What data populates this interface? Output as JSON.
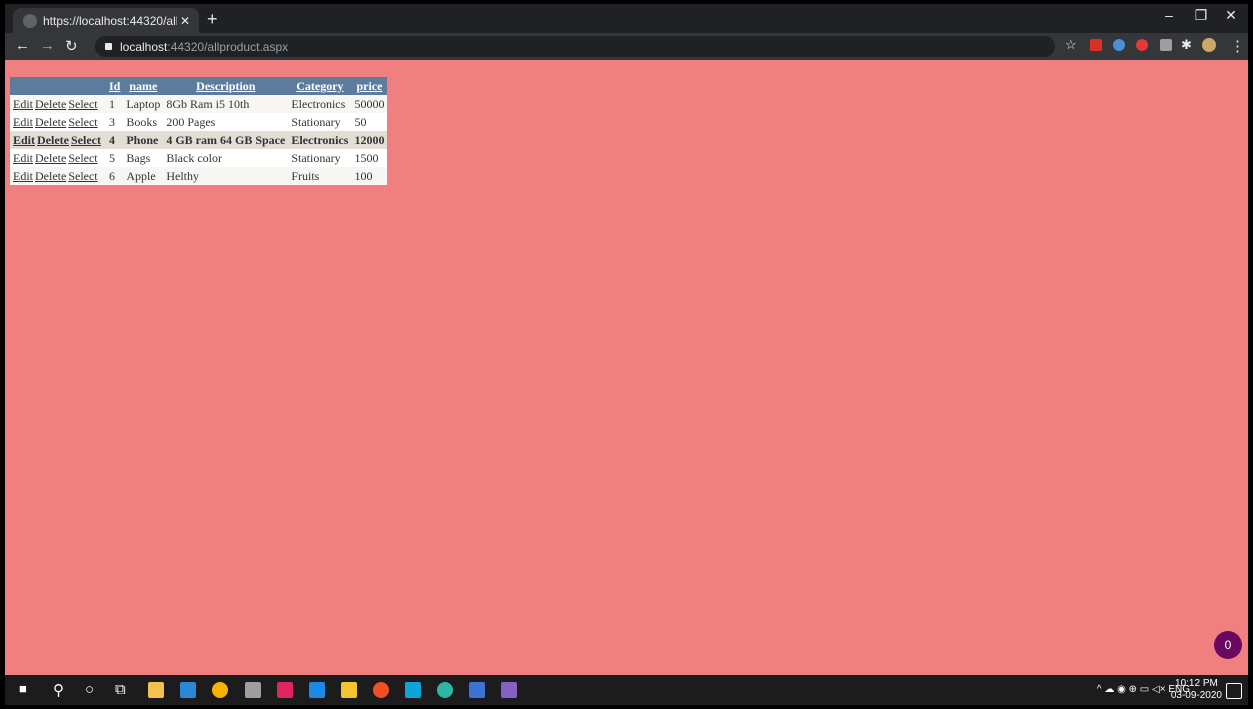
{
  "browser": {
    "tab_title": "https://localhost:44320/allproduc",
    "tab_close": "✕",
    "new_tab": "+",
    "url_host": "localhost",
    "url_path": ":44320/allproduct.aspx",
    "window_minimize": "–",
    "window_maximize": "❐",
    "window_close": "✕"
  },
  "grid": {
    "headers": {
      "id": "Id",
      "name": "name",
      "description": "Description",
      "category": "Category",
      "price": "price"
    },
    "actions": {
      "edit": "Edit",
      "delete": "Delete",
      "select": "Select"
    },
    "rows": [
      {
        "id": "1",
        "name": "Laptop",
        "description": "8Gb Ram i5 10th",
        "category": "Electronics",
        "price": "50000"
      },
      {
        "id": "3",
        "name": "Books",
        "description": "200 Pages",
        "category": "Stationary",
        "price": "50"
      },
      {
        "id": "4",
        "name": "Phone",
        "description": "4 GB ram 64 GB Space",
        "category": "Electronics",
        "price": "12000"
      },
      {
        "id": "5",
        "name": "Bags",
        "description": "Black color",
        "category": "Stationary",
        "price": "1500"
      },
      {
        "id": "6",
        "name": "Apple",
        "description": "Helthy",
        "category": "Fruits",
        "price": "100"
      }
    ]
  },
  "badge_count": "0",
  "taskbar": {
    "language": "ENG",
    "time": "10:12 PM",
    "date": "03-09-2020"
  },
  "colors": {
    "page_background": "#f08080",
    "grid_header": "#5d7b9d",
    "selected_row": "#e2ded6",
    "badge": "#6a0a5e"
  }
}
